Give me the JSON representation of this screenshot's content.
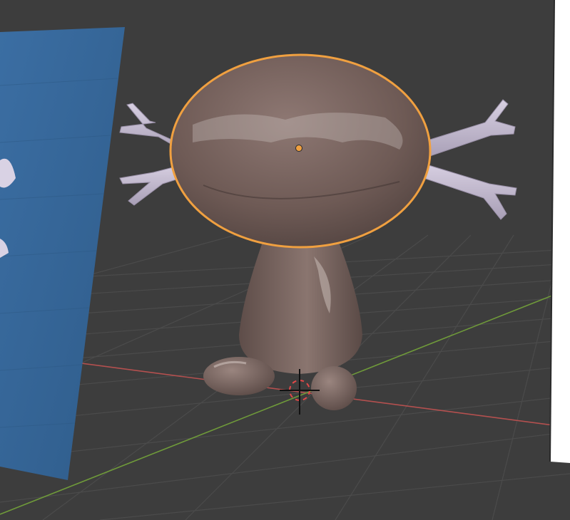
{
  "app": {
    "name": "3D viewport",
    "mode": "perspective"
  },
  "colors": {
    "background": "#3d3d3d",
    "grid": "#4a4a4a",
    "x_axis": "#b4504f",
    "y_axis": "#6f9a3a",
    "selection_outline": "#f0a040",
    "object_body": "#7d6761",
    "arm_color": "#c8c0d2",
    "reference_plane": "#3f6b98"
  },
  "scene": {
    "objects": [
      {
        "name": "reference-image-plane",
        "selected": false
      },
      {
        "name": "character-head",
        "selected": true,
        "active": true
      },
      {
        "name": "character-body",
        "selected": false
      },
      {
        "name": "character-feet",
        "selected": false
      },
      {
        "name": "character-gills",
        "selected": false
      },
      {
        "name": "white-panel",
        "selected": false
      }
    ],
    "cursor_icon": "3d-cursor-icon",
    "origin_icon": "object-origin-icon"
  }
}
